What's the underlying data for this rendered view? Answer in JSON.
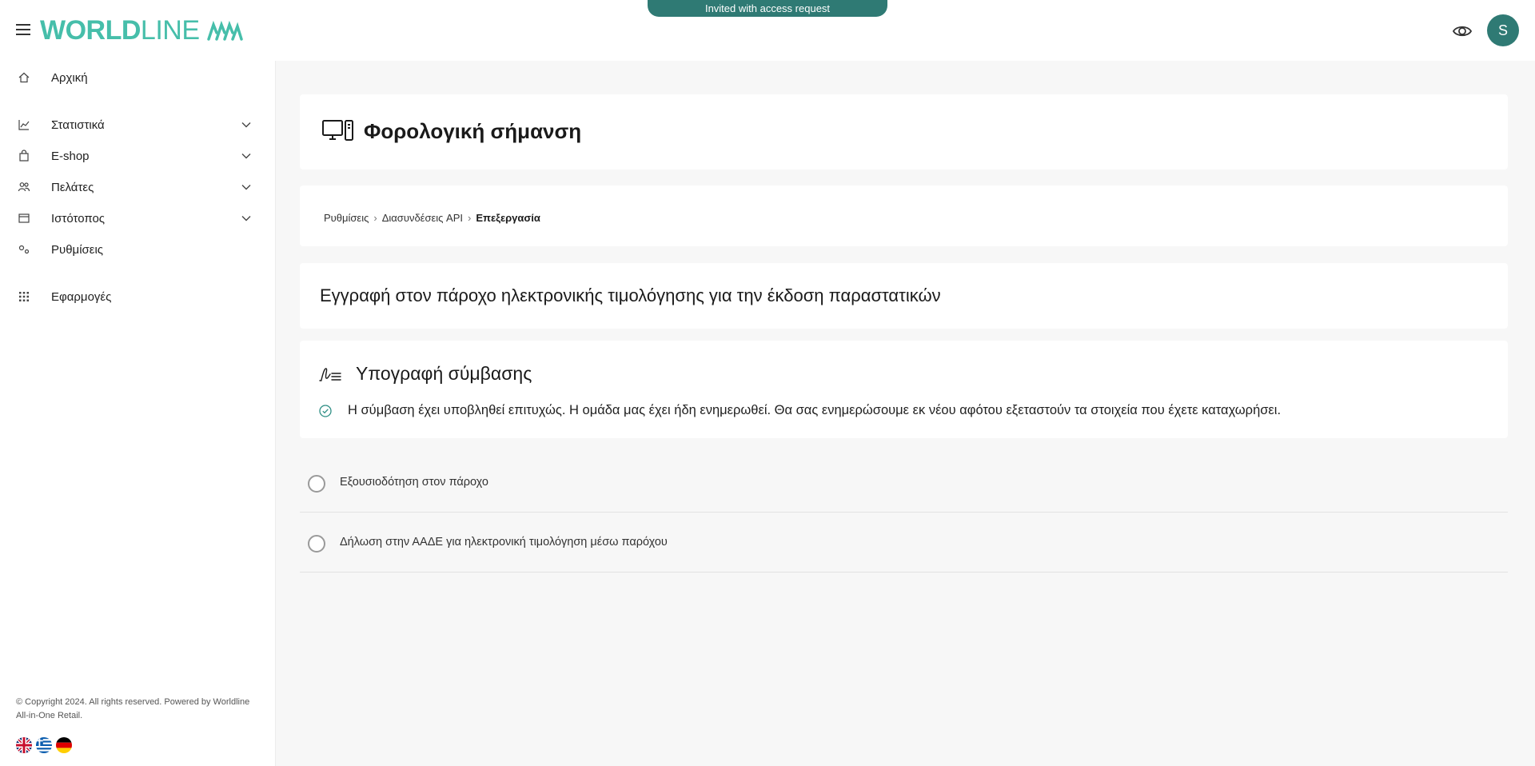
{
  "header": {
    "logo_bold": "WORLD",
    "logo_light": "LINE",
    "invite_banner": "Invited with access request",
    "avatar_initial": "S"
  },
  "sidebar": {
    "items": [
      {
        "label": "Αρχική",
        "icon": "home-icon"
      },
      {
        "label": "Στατιστικά",
        "icon": "chart-icon"
      },
      {
        "label": "E-shop",
        "icon": "shopping-bag-icon"
      },
      {
        "label": "Πελάτες",
        "icon": "users-icon"
      },
      {
        "label": "Ιστότοπος",
        "icon": "browser-icon"
      },
      {
        "label": "Ρυθμίσεις",
        "icon": "settings-icon"
      },
      {
        "label": "Εφαρμογές",
        "icon": "apps-grid-icon"
      }
    ],
    "copyright": "© Copyright 2024. All rights reserved. Powered by Worldline All-in-One Retail.",
    "languages": [
      "English",
      "Ελληνικά",
      "Deutsch"
    ]
  },
  "main": {
    "page_title": "Φορολογική σήμανση",
    "breadcrumb": [
      "Ρυθμίσεις",
      "Διασυνδέσεις API",
      "Επεξεργασία"
    ],
    "registration_title": "Εγγραφή στον πάροχο ηλεκτρονικής τιμολόγησης για την έκδοση παραστατικών",
    "signature": {
      "title": "Υπογραφή σύμβασης",
      "message": "Η σύμβαση έχει υποβληθεί επιτυχώς. Η ομάδα μας έχει ήδη ενημερωθεί. Θα σας ενημερώσουμε εκ νέου αφότου εξεταστούν τα στοιχεία που έχετε καταχωρήσει."
    },
    "steps": [
      {
        "label": "Εξουσιοδότηση στον πάροχο"
      },
      {
        "label": "Δήλωση στην ΑΑΔΕ για ηλεκτρονική τιμολόγηση μέσω παρόχου"
      }
    ]
  },
  "colors": {
    "brand": "#46beaa",
    "brand_dark": "#2f7a74",
    "background": "#f7f7f7"
  }
}
